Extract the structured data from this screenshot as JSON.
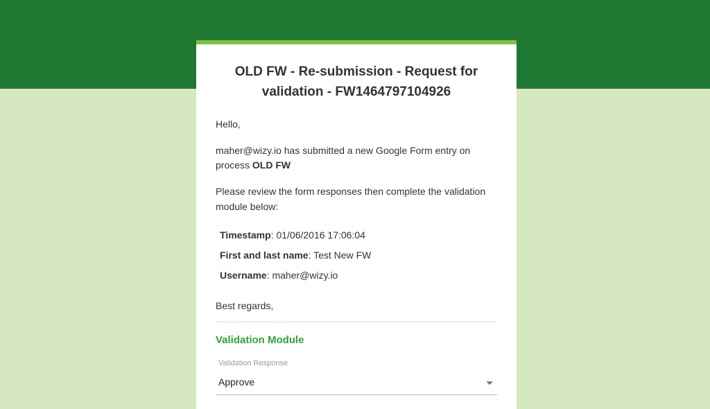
{
  "title": "OLD FW - Re-submission - Request for validation - FW1464797104926",
  "greeting": "Hello,",
  "intro_prefix": "maher@wizy.io has submitted a new Google Form entry on process ",
  "intro_bold": "OLD FW",
  "instruction": "Please review the form responses then complete the validation module below:",
  "details": {
    "ts_label": "Timestamp",
    "ts_value": ": 01/06/2016 17:06:04",
    "name_label": "First and last name",
    "name_value": ": Test New FW",
    "user_label": "Username",
    "user_value": ": maher@wizy.io"
  },
  "regards": "Best regards,",
  "module_title": "Validation Module",
  "field_label": "Validation Response",
  "selected": "Approve"
}
